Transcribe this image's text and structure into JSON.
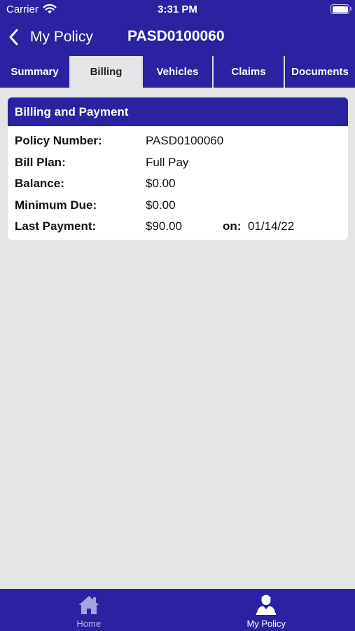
{
  "status_bar": {
    "carrier": "Carrier",
    "time": "3:31 PM"
  },
  "header": {
    "back_label": "My Policy",
    "title": "PASD0100060"
  },
  "tabs": [
    {
      "label": "Summary",
      "active": false
    },
    {
      "label": "Billing",
      "active": true
    },
    {
      "label": "Vehicles",
      "active": false
    },
    {
      "label": "Claims",
      "active": false
    },
    {
      "label": "Documents",
      "active": false
    }
  ],
  "billing_card": {
    "title": "Billing and Payment",
    "policy_number": {
      "label": "Policy Number:",
      "value": "PASD0100060"
    },
    "bill_plan": {
      "label": "Bill Plan:",
      "value": "Full Pay"
    },
    "balance": {
      "label": "Balance:",
      "value": "$0.00"
    },
    "minimum_due": {
      "label": "Minimum Due:",
      "value": "$0.00"
    },
    "last_payment": {
      "label": "Last Payment:",
      "value": "$90.00",
      "on_label": "on:",
      "date": "01/14/22"
    }
  },
  "bottom_nav": [
    {
      "label": "Home",
      "icon": "home-icon",
      "active": false
    },
    {
      "label": "My Policy",
      "icon": "person-icon",
      "active": true
    }
  ],
  "colors": {
    "primary": "#2a22a0",
    "background": "#e4e5e7",
    "card": "#ffffff"
  }
}
